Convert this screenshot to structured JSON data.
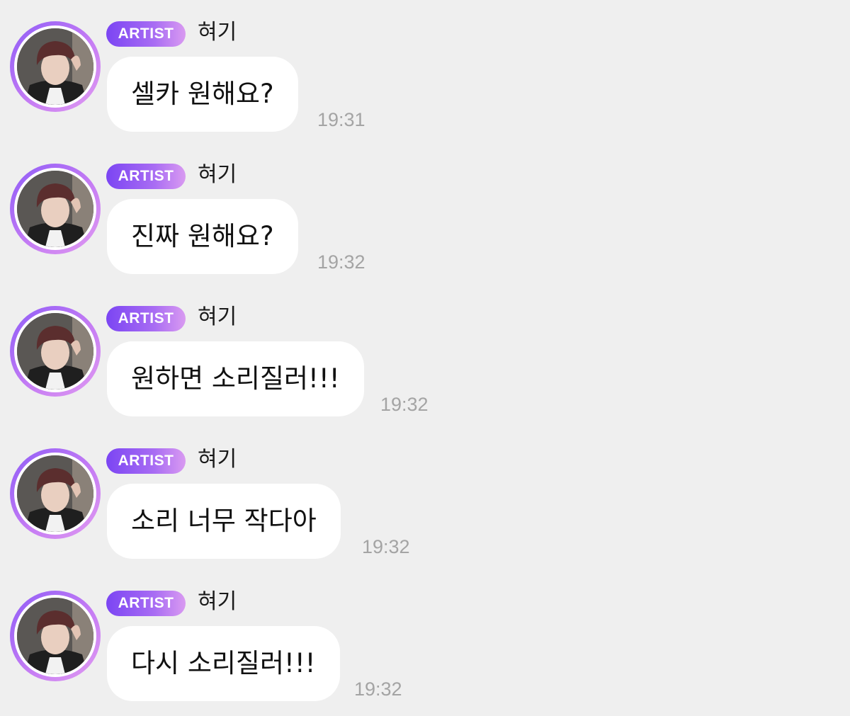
{
  "messages": [
    {
      "badge": "ARTIST",
      "sender": "혀기",
      "text": "셀카 원해요?",
      "time": "19:31"
    },
    {
      "badge": "ARTIST",
      "sender": "혀기",
      "text": "진짜 원해요?",
      "time": "19:32"
    },
    {
      "badge": "ARTIST",
      "sender": "혀기",
      "text": "원하면 소리질러!!!",
      "time": "19:32"
    },
    {
      "badge": "ARTIST",
      "sender": "혀기",
      "text": "소리 너무 작다아",
      "time": "19:32"
    },
    {
      "badge": "ARTIST",
      "sender": "혀기",
      "text": "다시 소리질러!!!",
      "time": "19:32"
    }
  ],
  "colors": {
    "background": "#efefef",
    "bubble": "#ffffff",
    "badge_start": "#7b45f3",
    "badge_end": "#d99af1",
    "timestamp": "#a4a4a4"
  },
  "icons": {
    "avatar": "profile-photo"
  }
}
